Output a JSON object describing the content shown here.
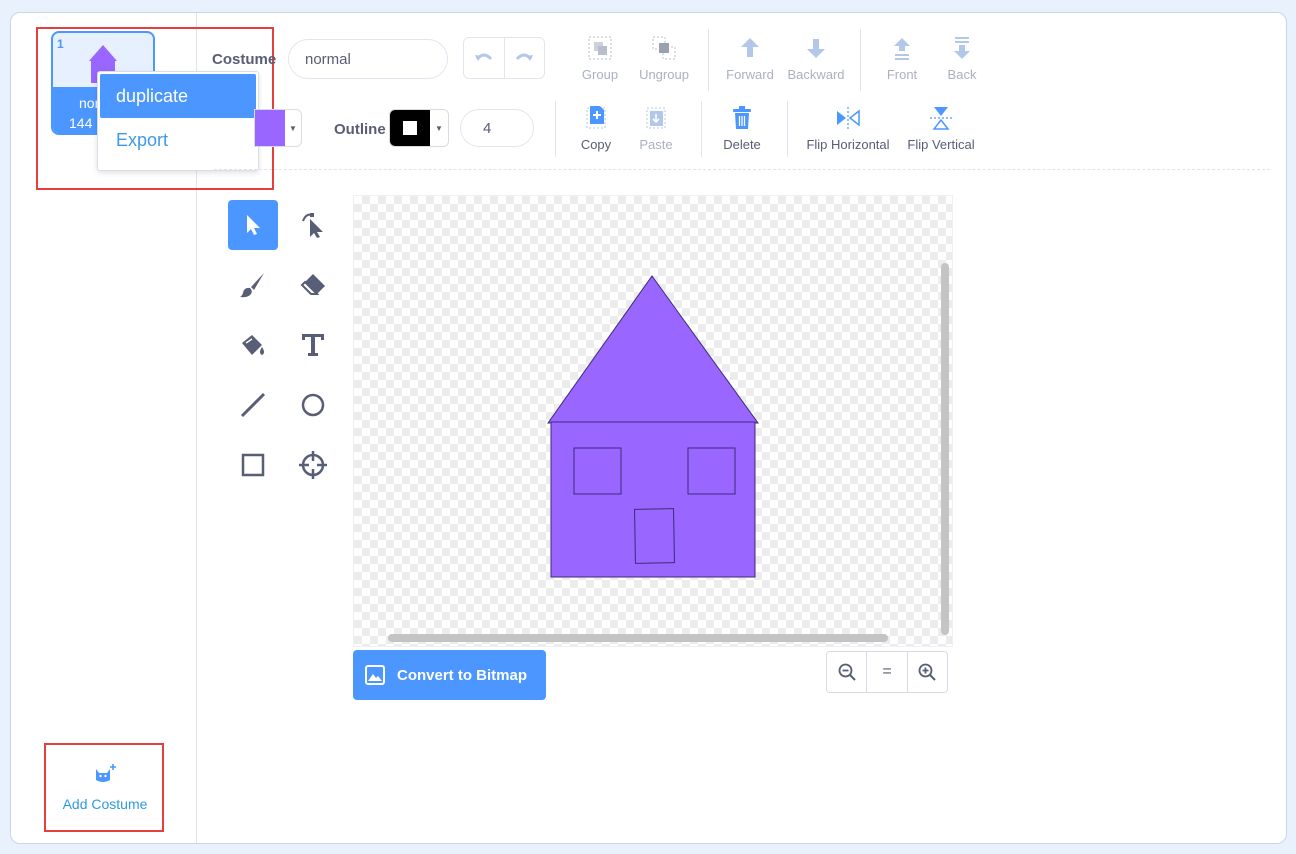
{
  "sidebar": {
    "costume": {
      "index": "1",
      "name": "normal",
      "name_truncated": "nor",
      "size": "144 × 171",
      "size_truncated": "144"
    },
    "context_menu": [
      {
        "label": "duplicate",
        "active": true
      },
      {
        "label": "Export",
        "active": false
      }
    ],
    "add_costume_label": "Add Costume"
  },
  "toolbar": {
    "costume_label": "Costume",
    "costume_name": "normal",
    "group_label": "Group",
    "ungroup_label": "Ungroup",
    "forward_label": "Forward",
    "backward_label": "Backward",
    "front_label": "Front",
    "back_label": "Back",
    "fill_color": "#9966ff",
    "outline_label": "Outline",
    "outline_color": "#000000",
    "outline_width": "4",
    "copy_label": "Copy",
    "paste_label": "Paste",
    "delete_label": "Delete",
    "flip_h_label": "Flip Horizontal",
    "flip_v_label": "Flip Vertical"
  },
  "tools": [
    "select",
    "reshape",
    "brush",
    "eraser",
    "fill",
    "text",
    "line",
    "circle",
    "rectangle",
    "center"
  ],
  "canvas": {
    "house_color": "#9966ff"
  },
  "bottom": {
    "convert_label": "Convert to Bitmap",
    "zoom_reset": "="
  },
  "colors": {
    "accent": "#4c97ff",
    "highlight": "#e53e3e"
  }
}
